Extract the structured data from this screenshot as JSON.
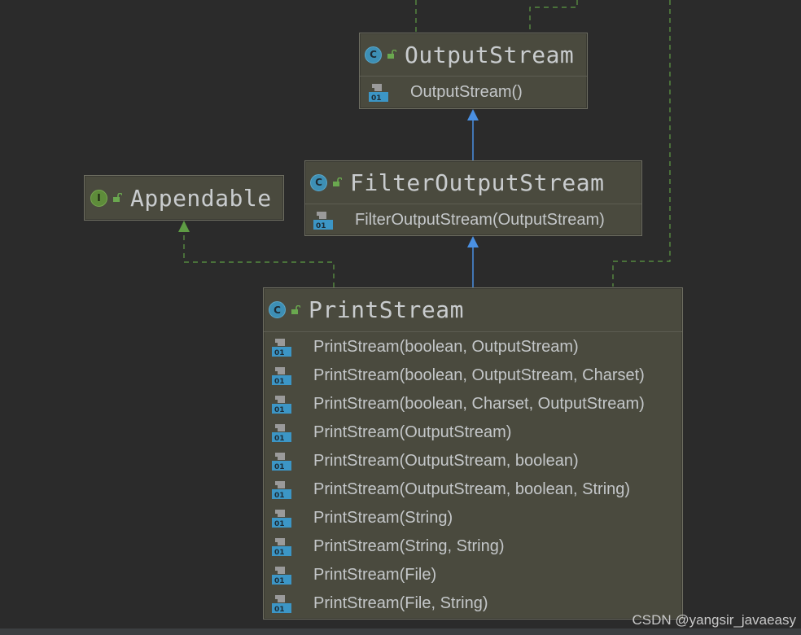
{
  "diagram": {
    "nodes": {
      "output_stream": {
        "kind": "C",
        "title": "OutputStream",
        "members": [
          "OutputStream()"
        ]
      },
      "filter_output_stream": {
        "kind": "C",
        "title": "FilterOutputStream",
        "members": [
          "FilterOutputStream(OutputStream)"
        ]
      },
      "appendable": {
        "kind": "I",
        "title": "Appendable",
        "members": []
      },
      "print_stream": {
        "kind": "C",
        "title": "PrintStream",
        "members": [
          "PrintStream(boolean, OutputStream)",
          "PrintStream(boolean, OutputStream, Charset)",
          "PrintStream(boolean, Charset, OutputStream)",
          "PrintStream(OutputStream)",
          "PrintStream(OutputStream, boolean)",
          "PrintStream(OutputStream, boolean, String)",
          "PrintStream(String)",
          "PrintStream(String, String)",
          "PrintStream(File)",
          "PrintStream(File, String)"
        ]
      }
    },
    "edges": [
      {
        "from": "filter_output_stream",
        "to": "output_stream",
        "type": "extends"
      },
      {
        "from": "print_stream",
        "to": "filter_output_stream",
        "type": "extends"
      },
      {
        "from": "print_stream",
        "to": "appendable",
        "type": "implements"
      }
    ],
    "colors": {
      "background": "#2b2b2b",
      "node_fill": "#4a4a3e",
      "extends_arrow": "#4a90e2",
      "implements_arrow": "#5e9c44"
    }
  },
  "watermark": "CSDN @yangsir_javaeasy"
}
